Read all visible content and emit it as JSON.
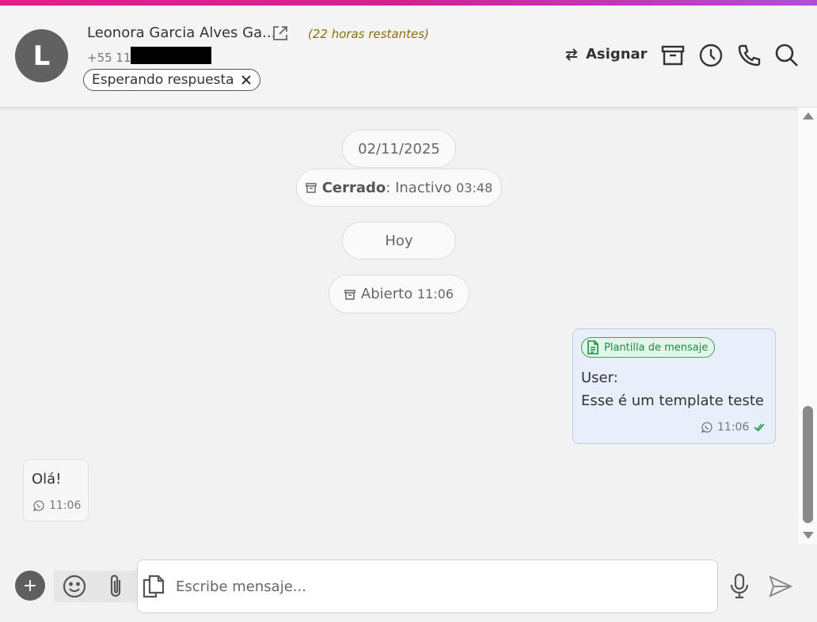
{
  "header": {
    "avatar_letter": "L",
    "contact_name": "Leonora Garcia Alves Ga...",
    "time_remaining": "(22 horas restantes)",
    "phone_prefix": "+55 11",
    "status_chip": "Esperando respuesta",
    "assign_label": "Asignar",
    "icons": [
      "swap-icon",
      "archive-icon",
      "clock-icon",
      "phone-icon",
      "search-icon",
      "external-link-icon",
      "close-icon"
    ]
  },
  "chat": {
    "events": [
      {
        "type": "date",
        "text": "02/11/2025"
      },
      {
        "type": "status",
        "bold": "Cerrado",
        "text": ": Inactivo",
        "time": "03:48"
      },
      {
        "type": "date",
        "text": "Hoy"
      },
      {
        "type": "status",
        "bold": "",
        "text": "Abierto",
        "time": "11:06"
      }
    ],
    "outgoing": {
      "tag": "Plantilla de mensaje",
      "line1": "User:",
      "line2": "Esse é um template teste",
      "time": "11:06",
      "status": "read"
    },
    "incoming": {
      "text": "Olá!",
      "time": "11:06"
    }
  },
  "composer": {
    "plus_label": "+",
    "placeholder": "Escribe mensaje..."
  },
  "colors": {
    "accent_gradient": [
      "#e91e8c",
      "#b04fd8"
    ],
    "template_green": "#1f8a45",
    "remaining_text": "#8a6d0b"
  }
}
